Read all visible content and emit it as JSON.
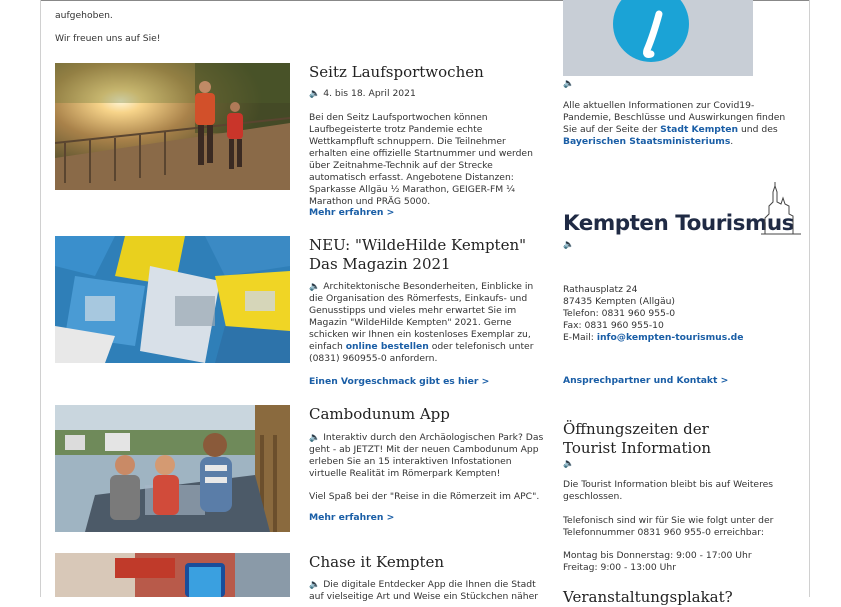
{
  "intro": {
    "line1": "aufgehoben.",
    "line2": "Wir freuen uns auf Sie!"
  },
  "articles": [
    {
      "title": "Seitz Laufsportwochen",
      "date": "4. bis 18. April 2021",
      "body": "Bei den Seitz Laufsportwochen können Laufbegeisterte trotz Pandemie echte Wettkampfluft schnuppern. Die Teilnehmer erhalten eine offizielle Startnummer und werden über Zeitnahme-Technik auf der Strecke automatisch erfasst. Angebotene Distanzen: Sparkasse Allgäu ½ Marathon, GEIGER-FM ¼ Marathon und PRÄG 5000.",
      "more": "Mehr erfahren  >"
    },
    {
      "title_line1": "NEU: \"WildeHilde Kempten\"",
      "title_line2": "Das Magazin 2021",
      "body_pre": "Architektonische Besonderheiten, Einblicke in die Organisation des Römerfests, Einkaufs- und Genusstipps und vieles mehr erwartet Sie im Magazin \"WildeHilde Kempten\" 2021. Gerne schicken wir Ihnen ein kostenloses Exemplar zu, einfach",
      "body_link": "online bestellen",
      "body_post": "oder telefonisch unter (0831) 960955-0 anfordern.",
      "more": "Einen Vorgeschmack gibt es hier  >"
    },
    {
      "title": "Cambodunum App",
      "body": "Interaktiv durch den Archäologischen Park? Das geht - ab JETZT! Mit der neuen Cambodunum App erleben Sie an 15 interaktiven Infostationen virtuelle Realität im Römerpark Kempten!",
      "body2": "Viel Spaß bei der \"Reise in die Römerzeit im APC\".",
      "more": "Mehr erfahren  >"
    },
    {
      "title": "Chase it Kempten",
      "body": "Die digitale Entdecker App die Ihnen die Stadt auf vielseitige Art und Weise ein Stückchen näher"
    }
  ],
  "sidebar": {
    "covid_pre": "Alle aktuellen Informationen zur Covid19-Pandemie, Beschlüsse und Auswirkungen finden Sie auf der Seite der",
    "covid_link1": "Stadt Kempten",
    "covid_mid": "und des",
    "covid_link2": "Bayerischen Staatsministeriums",
    "covid_end": ".",
    "logo_text": "Kempten Tourismus",
    "address": {
      "street": "Rathausplatz 24",
      "city": "87435 Kempten (Allgäu)",
      "phone": "Telefon: 0831 960 955-0",
      "fax": "Fax: 0831 960 955-10",
      "email_label": "E-Mail:",
      "email": "info@kempten-tourismus.de"
    },
    "contact_link": "Ansprechpartner und Kontakt  >",
    "hours_title_line1": "Öffnungszeiten der",
    "hours_title_line2": "Tourist Information",
    "hours_p1": "Die Tourist Information bleibt bis auf Weiteres geschlossen.",
    "hours_p2": "Telefonisch sind wir für Sie wie folgt unter der Telefonnummer 0831 960 955-0 erreichbar:",
    "hours_p3_line1": "Montag bis Donnerstag: 9:00 - 17:00 Uhr",
    "hours_p3_line2": "Freitag: 9:00 - 13:00 Uhr",
    "next_title": "Veranstaltungsplakat?"
  },
  "icons": {
    "speaker": "🔈"
  },
  "colors": {
    "link": "#1a5ea6",
    "info_circle": "#1ba3d6",
    "info_bg": "#c8ced6"
  }
}
